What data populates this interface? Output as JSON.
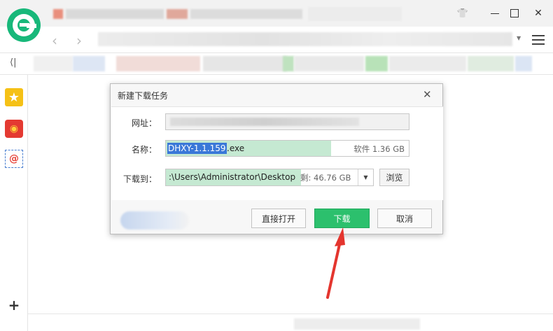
{
  "dialog": {
    "title": "新建下载任务",
    "url_label": "网址：",
    "name_label": "名称：",
    "name_selected": "DHXY-1.1.159",
    "name_extension": ".exe",
    "file_info": "软件 1.36 GB",
    "save_label": "下载到：",
    "save_path": ":\\Users\\Administrator\\Desktop",
    "free_space": "剩: 46.76 GB",
    "browse_label": "浏览",
    "open_directly_label": "直接打开",
    "download_label": "下载",
    "cancel_label": "取消"
  },
  "sidebar": {
    "icons": [
      "star-icon",
      "weibo-icon",
      "mail-icon",
      "add-icon"
    ]
  },
  "colors": {
    "brand": "#18b87a",
    "download_button": "#2cc06d",
    "highlight_fill": "#c5e9d2",
    "selection": "#3a78d8"
  }
}
